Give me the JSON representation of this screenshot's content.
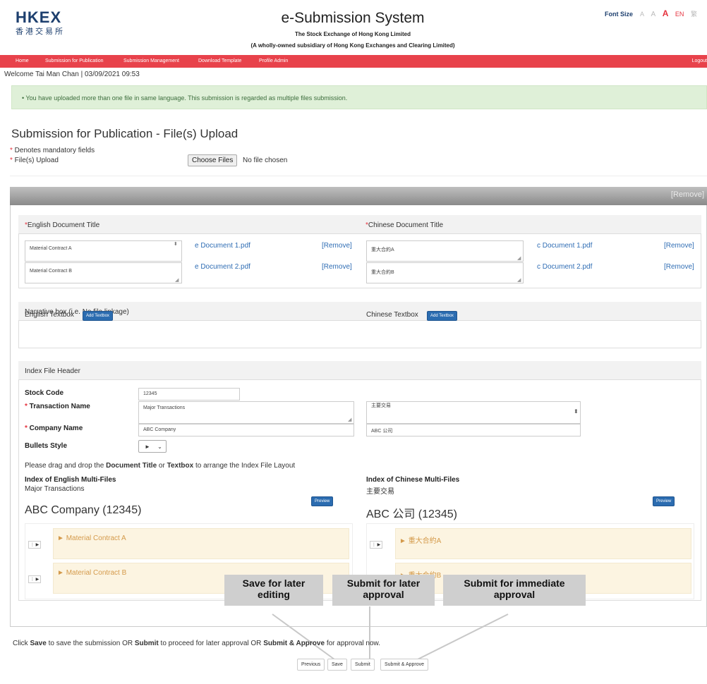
{
  "header": {
    "logo_en": "HKEX",
    "logo_zh": "香港交易所",
    "system_title": "e-Submission System",
    "subtitle1": "The Stock Exchange of Hong Kong Limited",
    "subtitle2": "(A wholly-owned subsidiary of Hong Kong Exchanges and Clearing Limited)",
    "font_size_label": "Font Size",
    "font_a_small": "A",
    "font_a_medium": "A",
    "font_a_large": "A",
    "lang_en": "EN",
    "lang_zh": "繁"
  },
  "nav": {
    "home": "Home",
    "submission_publication": "Submission for Publication",
    "submission_management": "Submission Management",
    "download_template": "Download Template",
    "profile_admin": "Profile Admin",
    "logout": "Logout"
  },
  "welcome": "Welcome Tai Man Chan | 03/09/2021 09:53",
  "alert": "• You have uploaded more than one file in same language. This submission is regarded as multiple files submission.",
  "page": {
    "title": "Submission for Publication - File(s) Upload",
    "mandatory_asterisk": "*",
    "mandatory_note": " Denotes mandatory fields",
    "upload_label": " File(s) Upload",
    "choose_files": "Choose Files",
    "no_file": "No file chosen",
    "remove_all": "[Remove]"
  },
  "titles": {
    "english_header": "English Document Title",
    "chinese_header": "Chinese Document Title",
    "en_rows": [
      {
        "title": "Material Contract A",
        "file": "e Document 1.pdf",
        "remove": "[Remove]"
      },
      {
        "title": "Material Contract B",
        "file": "e Document 2.pdf",
        "remove": "[Remove]"
      }
    ],
    "zh_rows": [
      {
        "title": "重大合約A",
        "file": "c Document 1.pdf",
        "remove": "[Remove]"
      },
      {
        "title": "重大合約B",
        "file": "c Document 2.pdf",
        "remove": "[Remove]"
      }
    ]
  },
  "narrative": {
    "header": "Narrative box (i.e. No file linkage)",
    "english_label": "English Textbox",
    "chinese_label": "Chinese Textbox",
    "add_textbox": "Add Textbox"
  },
  "index_header": {
    "header": "Index File Header",
    "stock_code_label": "Stock Code",
    "stock_code_value": "12345",
    "transaction_label": " Transaction Name",
    "transaction_en": "Major Transactions",
    "transaction_zh": "主要交易",
    "company_label": " Company Name",
    "company_en": "ABC Company",
    "company_zh": "ABC 公司",
    "bullets_label": "Bullets Style",
    "bullets_value": "►",
    "drag_pre": "Please drag and drop the ",
    "drag_doc": "Document Title",
    "drag_or": " or ",
    "drag_textbox": "Textbox",
    "drag_post": " to arrange the Index File Layout"
  },
  "index_en": {
    "heading": "Index of English Multi-Files",
    "subtitle": "Major Transactions",
    "company": "ABC Company (12345)",
    "preview": "Preview",
    "items": [
      "Material Contract A",
      "Material Contract B"
    ]
  },
  "index_zh": {
    "heading": "Index of Chinese Multi-Files",
    "subtitle": "主要交易",
    "company": "ABC 公司 (12345)",
    "preview": "Preview",
    "items": [
      "重大合約A",
      "重大合約B"
    ]
  },
  "callouts": {
    "save": "Save for later editing",
    "submit": "Submit for later approval",
    "submit_approve": "Submit for immediate approval"
  },
  "footer": {
    "inst_1": "Click ",
    "inst_save": "Save",
    "inst_2": " to save the submission OR ",
    "inst_submit": "Submit",
    "inst_3": " to proceed for later approval OR ",
    "inst_submit_approve": "Submit & Approve",
    "inst_4": " for approval now.",
    "previous": "Previous",
    "save": "Save",
    "submit": "Submit",
    "submit_approve": "Submit & Approve"
  }
}
